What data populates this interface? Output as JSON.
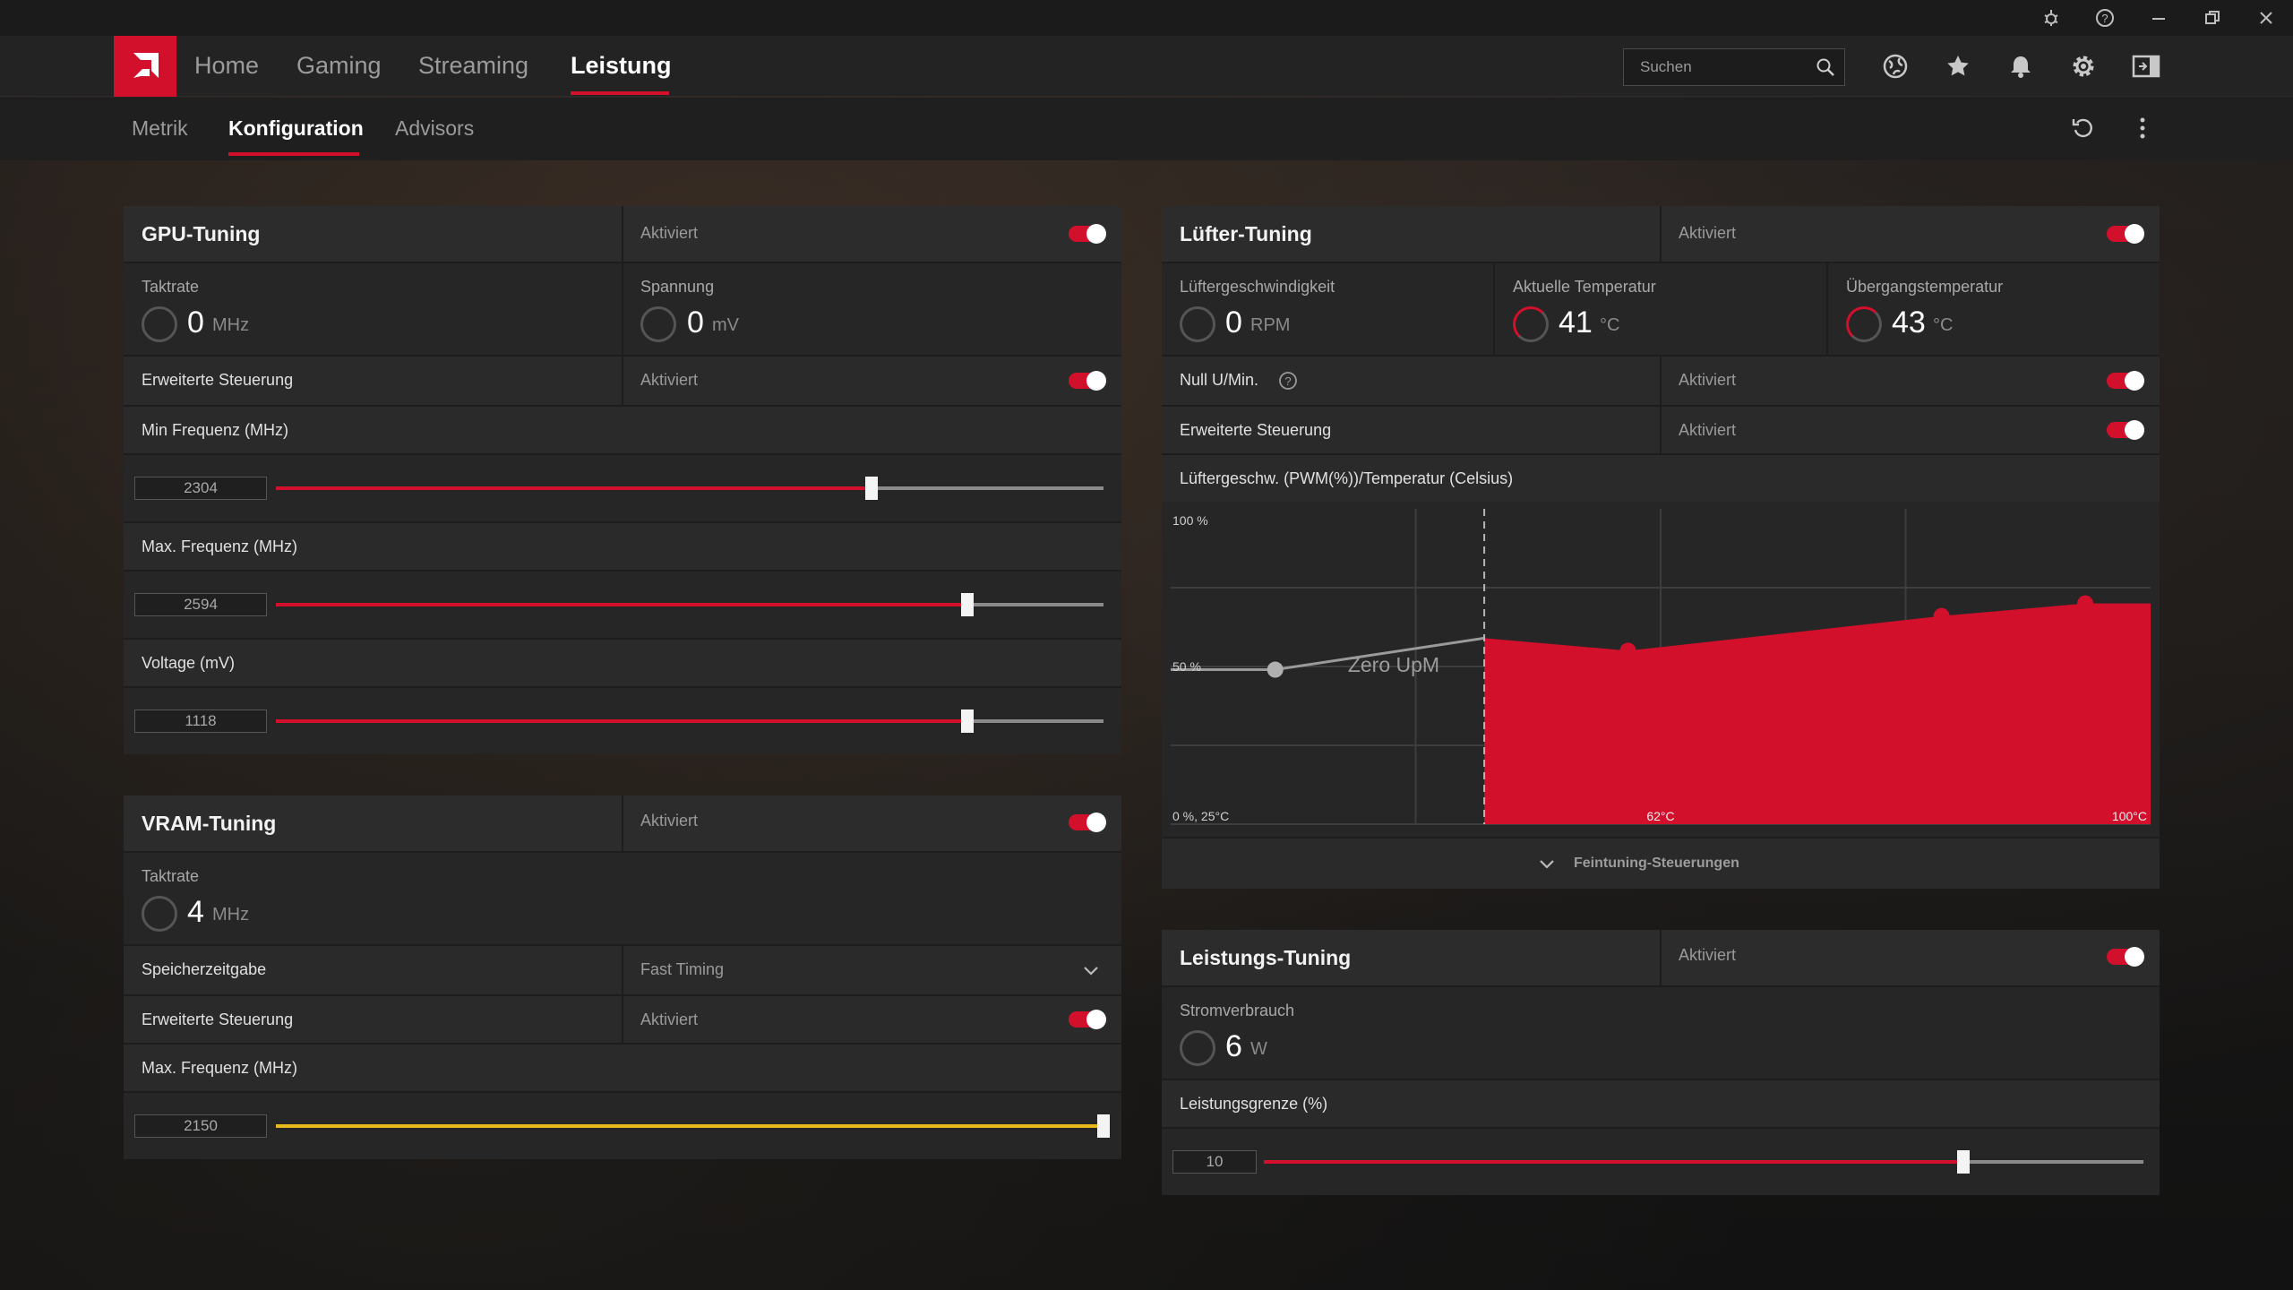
{
  "colors": {
    "accent": "#d2102c",
    "vram_accent": "#e8b81c"
  },
  "titlebar": {
    "icons": [
      "bug-icon",
      "help-icon",
      "minimize-icon",
      "restore-icon",
      "close-icon"
    ]
  },
  "nav": {
    "items": [
      {
        "label": "Home"
      },
      {
        "label": "Gaming"
      },
      {
        "label": "Streaming"
      },
      {
        "label": "Leistung"
      }
    ],
    "active": "Leistung",
    "search_placeholder": "Suchen",
    "icons": [
      "globe-icon",
      "star-icon",
      "bell-icon",
      "gear-icon",
      "sidebar-toggle-icon"
    ]
  },
  "subnav": {
    "items": [
      {
        "label": "Metrik"
      },
      {
        "label": "Konfiguration"
      },
      {
        "label": "Advisors"
      }
    ],
    "active": "Konfiguration",
    "icons": [
      "reset-icon",
      "more-icon"
    ]
  },
  "gpu": {
    "title": "GPU-Tuning",
    "status": "Aktiviert",
    "enabled": true,
    "clock_label": "Taktrate",
    "clock_value": "0",
    "clock_unit": "MHz",
    "voltage_label": "Spannung",
    "voltage_value": "0",
    "voltage_unit": "mV",
    "advanced_label": "Erweiterte Steuerung",
    "advanced_status": "Aktiviert",
    "advanced_enabled": true,
    "sliders": [
      {
        "label": "Min Frequenz (MHz)",
        "value": "2304",
        "fraction": 0.72
      },
      {
        "label": "Max. Frequenz (MHz)",
        "value": "2594",
        "fraction": 0.835
      },
      {
        "label": "Voltage (mV)",
        "value": "1118",
        "fraction": 0.835
      }
    ]
  },
  "vram": {
    "title": "VRAM-Tuning",
    "status": "Aktiviert",
    "enabled": true,
    "clock_label": "Taktrate",
    "clock_value": "4",
    "clock_unit": "MHz",
    "timing_label": "Speicherzeitgabe",
    "timing_value": "Fast Timing",
    "advanced_label": "Erweiterte Steuerung",
    "advanced_status": "Aktiviert",
    "advanced_enabled": true,
    "slider": {
      "label": "Max. Frequenz (MHz)",
      "value": "2150",
      "fraction": 1.0
    }
  },
  "fan": {
    "title": "Lüfter-Tuning",
    "status": "Aktiviert",
    "enabled": true,
    "speed_label": "Lüftergeschwindigkeit",
    "speed_value": "0",
    "speed_unit": "RPM",
    "temp_label": "Aktuelle Temperatur",
    "temp_value": "41",
    "temp_unit": "°C",
    "junction_label": "Übergangstemperatur",
    "junction_value": "43",
    "junction_unit": "°C",
    "zero_rpm_label": "Null U/Min.",
    "zero_rpm_status": "Aktiviert",
    "zero_rpm_enabled": true,
    "advanced_label": "Erweiterte Steuerung",
    "advanced_status": "Aktiviert",
    "advanced_enabled": true,
    "curve_title": "Lüftergeschw. (PWM(%))/Temperatur (Celsius)",
    "fine_tuning_label": "Feintuning-Steuerungen"
  },
  "power": {
    "title": "Leistungs-Tuning",
    "status": "Aktiviert",
    "enabled": true,
    "consumption_label": "Stromverbrauch",
    "consumption_value": "6",
    "consumption_unit": "W",
    "slider": {
      "label": "Leistungsgrenze (%)",
      "value": "10",
      "fraction": 0.795
    }
  },
  "chart_data": {
    "type": "area",
    "title": "Lüftergeschw. (PWM(%))/Temperatur (Celsius)",
    "xlim": [
      25,
      100
    ],
    "ylim": [
      0,
      100
    ],
    "y_tick_labels": [
      "100 %",
      "50 %",
      "0 %, 25°C"
    ],
    "x_tick_labels": [
      "62°C",
      "100°C"
    ],
    "zero_rpm_label": "Zero UpM",
    "zero_rpm_threshold": 49,
    "series": [
      {
        "x": [
          33,
          49,
          60,
          84,
          95,
          100
        ],
        "y": [
          49,
          59,
          55,
          66,
          70,
          70
        ]
      }
    ]
  }
}
